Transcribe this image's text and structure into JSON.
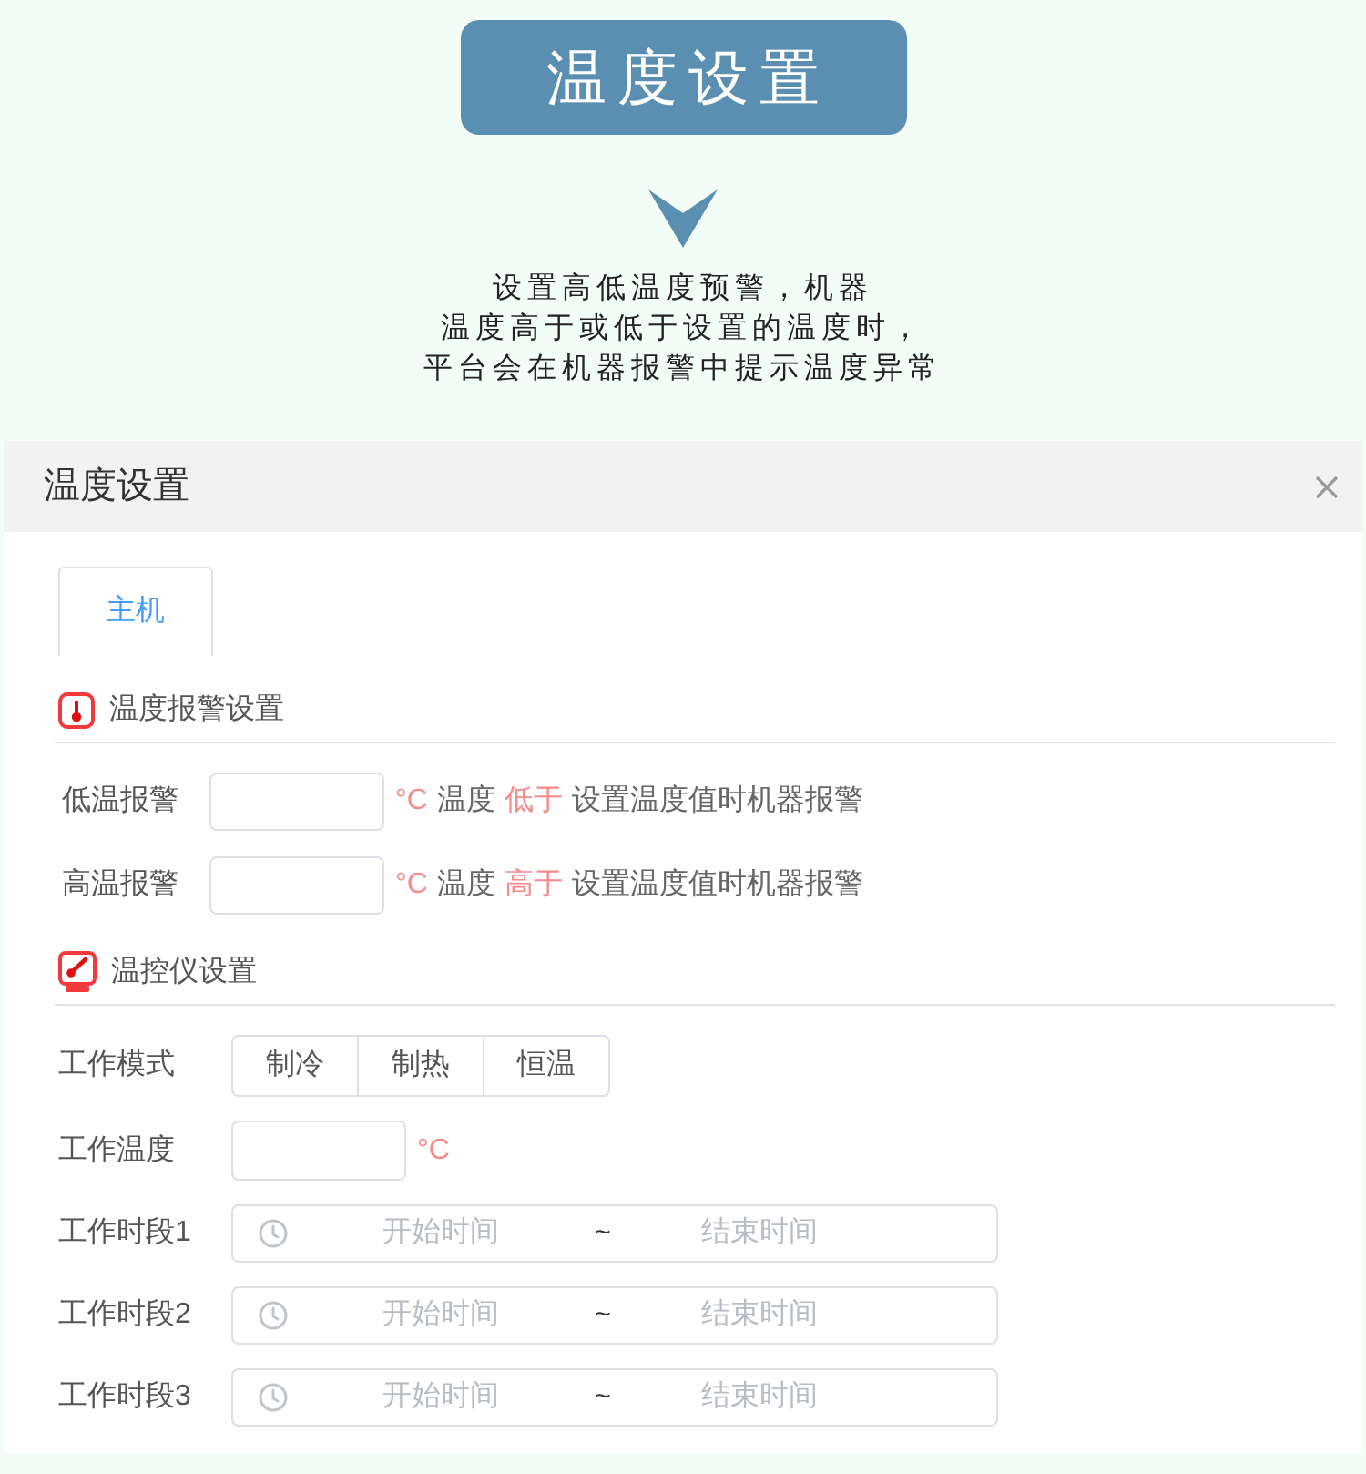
{
  "banner": {
    "title": "温度设置"
  },
  "description": [
    "设置高低温度预警，机器",
    "温度高于或低于设置的温度时，",
    "平台会在机器报警中提示温度异常"
  ],
  "dialog": {
    "title": "温度设置",
    "tabs": [
      {
        "label": "主机",
        "selected": true
      }
    ],
    "sections": [
      {
        "kind": "alarm",
        "title": "温度报警设置",
        "rows": [
          {
            "kind": "alarm",
            "label": "低温报警",
            "unit": "°C",
            "hint": [
              {
                "text": "温度",
                "emphasis": false
              },
              {
                "text": "低于",
                "emphasis": true
              },
              {
                "text": "设置温度值时机器报警",
                "emphasis": false
              }
            ]
          },
          {
            "kind": "alarm",
            "label": "高温报警",
            "unit": "°C",
            "hint": [
              {
                "text": "温度",
                "emphasis": false
              },
              {
                "text": "高于",
                "emphasis": true
              },
              {
                "text": "设置温度值时机器报警",
                "emphasis": false
              }
            ]
          }
        ]
      },
      {
        "kind": "controller",
        "title": "温控仪设置",
        "rows": [
          {
            "kind": "mode",
            "label": "工作模式",
            "options": [
              {
                "label": "制冷",
                "selected": false
              },
              {
                "label": "制热",
                "selected": false
              },
              {
                "label": "恒温",
                "selected": false
              }
            ]
          },
          {
            "kind": "temperature",
            "label": "工作温度",
            "unit": "°C"
          },
          {
            "kind": "period",
            "label": "工作时段1",
            "start_placeholder": "开始时间",
            "separator": "~",
            "end_placeholder": "结束时间"
          },
          {
            "kind": "period",
            "label": "工作时段2",
            "start_placeholder": "开始时间",
            "separator": "~",
            "end_placeholder": "结束时间"
          },
          {
            "kind": "period",
            "label": "工作时段3",
            "start_placeholder": "开始时间",
            "separator": "~",
            "end_placeholder": "结束时间"
          }
        ]
      }
    ]
  }
}
